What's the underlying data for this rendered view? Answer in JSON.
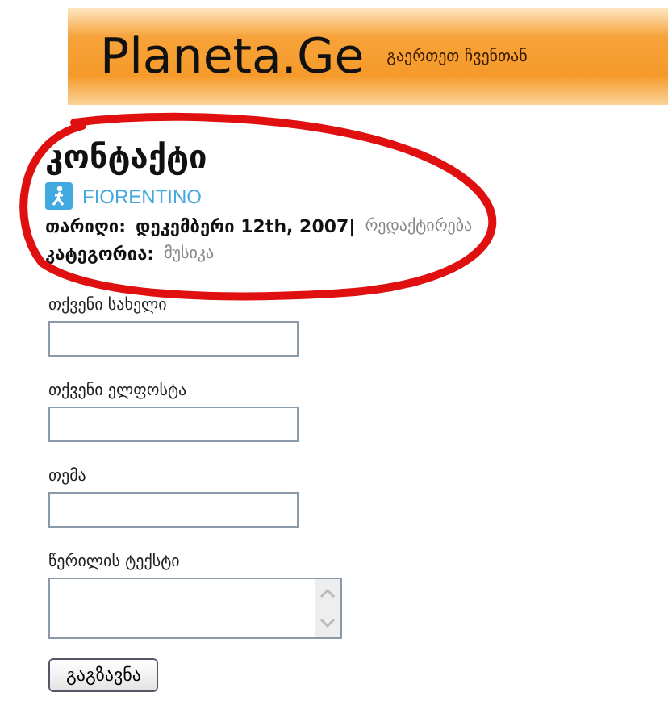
{
  "banner": {
    "logo": "Planeta.Ge",
    "tagline": "გაერთეთ ჩვენთან"
  },
  "post": {
    "title": "კონტაქტი",
    "author": "FIORENTINO",
    "date_label": "თარიღი:",
    "date": "დეკემბერი 12th, 2007|",
    "edit_link": "რედაქტირება",
    "category_label": "კატეგორია:",
    "category": "მუსიკა"
  },
  "form": {
    "fields": [
      {
        "label": "თქვენი სახელი",
        "kind": "input"
      },
      {
        "label": "თქვენი ელფოსტა",
        "kind": "input"
      },
      {
        "label": "თემა",
        "kind": "input"
      },
      {
        "label": "წერილის ტექსტი",
        "kind": "textarea"
      }
    ],
    "submit": "გაგზავნა"
  },
  "annotation": {
    "kind": "ellipse"
  }
}
